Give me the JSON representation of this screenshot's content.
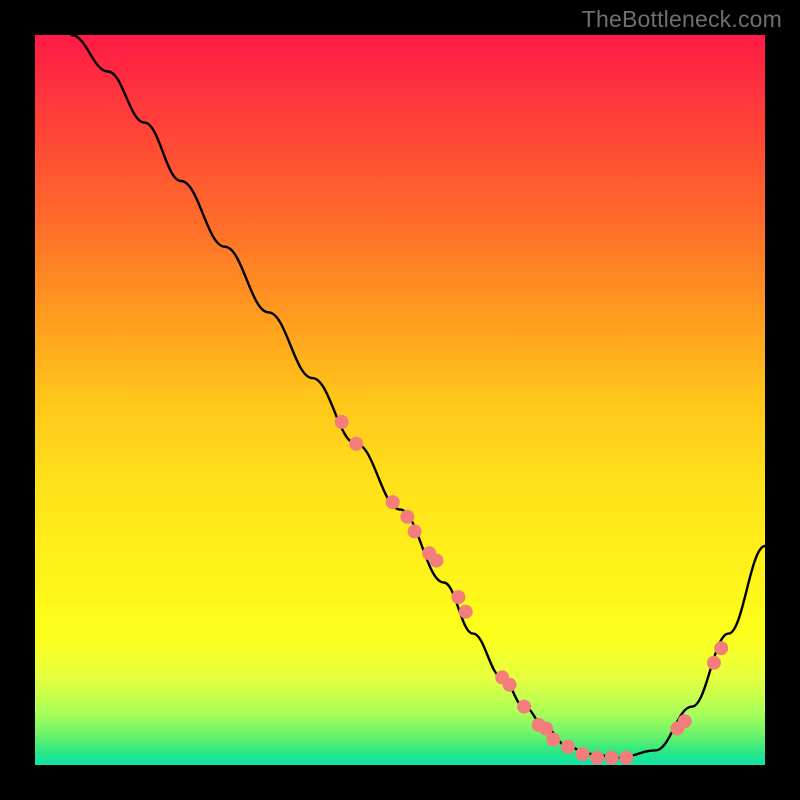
{
  "attribution": "TheBottleneck.com",
  "chart_data": {
    "type": "line",
    "title": "",
    "xlabel": "",
    "ylabel": "",
    "xlim": [
      0,
      100
    ],
    "ylim": [
      0,
      100
    ],
    "grid": false,
    "legend": false,
    "series": [
      {
        "name": "curve",
        "color": "#000000",
        "x": [
          5,
          10,
          15,
          20,
          26,
          32,
          38,
          44,
          50,
          56,
          60,
          64,
          67,
          70,
          73,
          76,
          80,
          85,
          90,
          95,
          100
        ],
        "values": [
          100,
          95,
          88,
          80,
          71,
          62,
          53,
          44,
          35,
          25,
          18,
          12,
          8,
          5,
          2.5,
          1.5,
          1,
          2,
          8,
          18,
          30
        ]
      }
    ],
    "markers": {
      "name": "highlight-points",
      "color": "#f27d7a",
      "radius_px": 7,
      "x": [
        42,
        44,
        49,
        51,
        52,
        54,
        55,
        58,
        59,
        64,
        65,
        67,
        69,
        70,
        71,
        73,
        75,
        77,
        79,
        81,
        88,
        89,
        93,
        94
      ],
      "values": [
        47,
        44,
        36,
        34,
        32,
        29,
        28,
        23,
        21,
        12,
        11,
        8,
        5.5,
        5,
        3.5,
        2.5,
        1.5,
        1,
        1,
        1,
        5,
        6,
        14,
        16
      ]
    },
    "background_gradient": {
      "direction": "vertical",
      "stops": [
        {
          "pos": 0.0,
          "color": "#ff1a46"
        },
        {
          "pos": 0.1,
          "color": "#ff3a3a"
        },
        {
          "pos": 0.25,
          "color": "#ff6a2b"
        },
        {
          "pos": 0.38,
          "color": "#ff9a1f"
        },
        {
          "pos": 0.5,
          "color": "#ffc61a"
        },
        {
          "pos": 0.62,
          "color": "#ffe21a"
        },
        {
          "pos": 0.74,
          "color": "#fff31a"
        },
        {
          "pos": 0.82,
          "color": "#fdff1a"
        },
        {
          "pos": 0.88,
          "color": "#e6ff3e"
        },
        {
          "pos": 0.93,
          "color": "#a8ff5a"
        },
        {
          "pos": 0.965,
          "color": "#5cf06e"
        },
        {
          "pos": 0.985,
          "color": "#22e68a"
        },
        {
          "pos": 1.0,
          "color": "#11e4a8"
        }
      ]
    }
  }
}
